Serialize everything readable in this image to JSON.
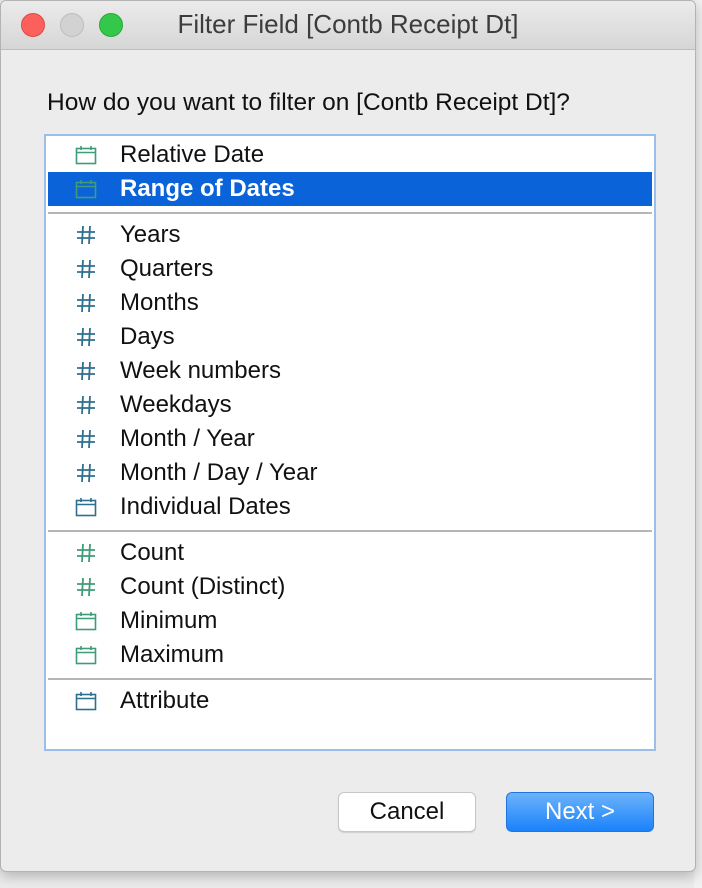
{
  "window": {
    "title": "Filter Field [Contb Receipt Dt]"
  },
  "dialog": {
    "question": "How do you want to filter on [Contb Receipt Dt]?",
    "groups": [
      [
        {
          "label": "Relative Date",
          "icon": "calendar-icon",
          "icon_color": "#3e9c78",
          "selected": false
        },
        {
          "label": "Range of Dates",
          "icon": "calendar-icon",
          "icon_color": "#3e9c78",
          "selected": true
        }
      ],
      [
        {
          "label": "Years",
          "icon": "hash-icon",
          "icon_color": "#2f6f8e",
          "selected": false
        },
        {
          "label": "Quarters",
          "icon": "hash-icon",
          "icon_color": "#2f6f8e",
          "selected": false
        },
        {
          "label": "Months",
          "icon": "hash-icon",
          "icon_color": "#2f6f8e",
          "selected": false
        },
        {
          "label": "Days",
          "icon": "hash-icon",
          "icon_color": "#2f6f8e",
          "selected": false
        },
        {
          "label": "Week numbers",
          "icon": "hash-icon",
          "icon_color": "#2f6f8e",
          "selected": false
        },
        {
          "label": "Weekdays",
          "icon": "hash-icon",
          "icon_color": "#2f6f8e",
          "selected": false
        },
        {
          "label": "Month / Year",
          "icon": "hash-icon",
          "icon_color": "#2f6f8e",
          "selected": false
        },
        {
          "label": "Month / Day / Year",
          "icon": "hash-icon",
          "icon_color": "#2f6f8e",
          "selected": false
        },
        {
          "label": "Individual Dates",
          "icon": "calendar-icon",
          "icon_color": "#2f6f8e",
          "selected": false
        }
      ],
      [
        {
          "label": "Count",
          "icon": "hash-icon",
          "icon_color": "#3e9c78",
          "selected": false
        },
        {
          "label": "Count (Distinct)",
          "icon": "hash-icon",
          "icon_color": "#3e9c78",
          "selected": false
        },
        {
          "label": "Minimum",
          "icon": "calendar-icon",
          "icon_color": "#3e9c78",
          "selected": false
        },
        {
          "label": "Maximum",
          "icon": "calendar-icon",
          "icon_color": "#3e9c78",
          "selected": false
        }
      ],
      [
        {
          "label": "Attribute",
          "icon": "calendar-icon",
          "icon_color": "#2f6f8e",
          "selected": false
        }
      ]
    ]
  },
  "buttons": {
    "cancel_label": "Cancel",
    "next_label": "Next >"
  },
  "colors": {
    "selection": "#0a63d8",
    "list_border": "#9bbfe8",
    "primary_button": "#1a82fb"
  }
}
